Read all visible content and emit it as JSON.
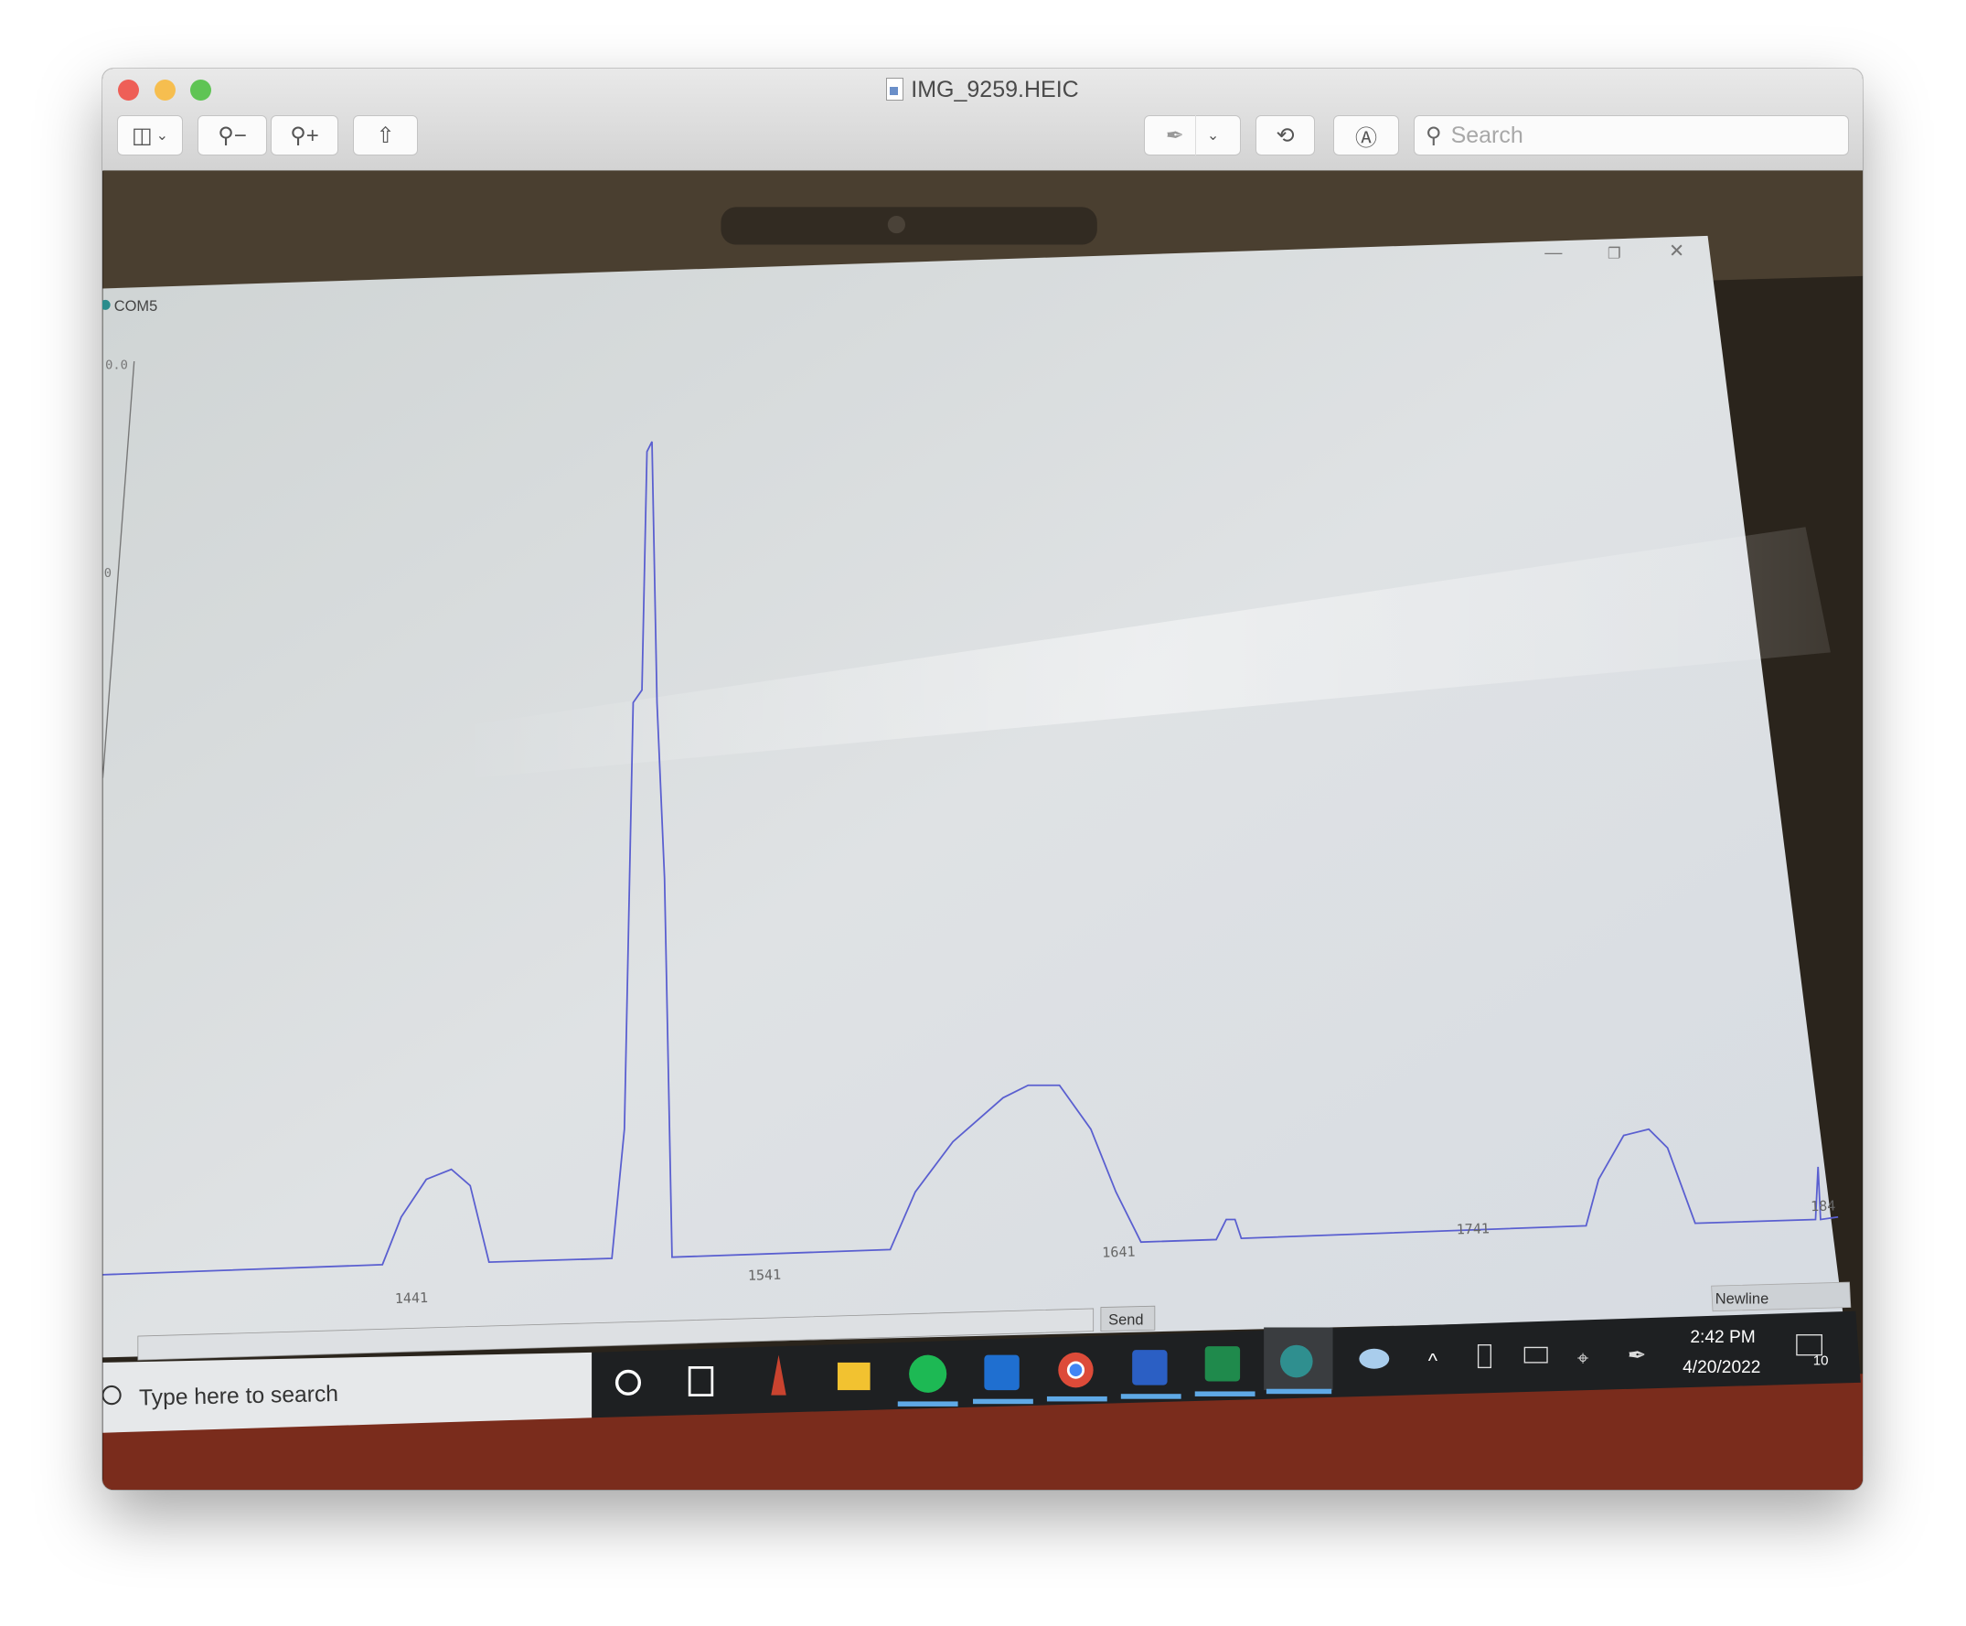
{
  "window": {
    "title": "IMG_9259.HEIC",
    "traffic_lights": {
      "close": "#ee5f57",
      "minimize": "#f6be4f",
      "zoom": "#5fc454"
    }
  },
  "toolbar": {
    "sidebar_icon": "sidebar-icon",
    "zoom_out_icon": "zoom-out-icon",
    "zoom_in_icon": "zoom-in-icon",
    "share_icon": "share-icon",
    "markup_icon": "highlighter-icon",
    "rotate_icon": "rotate-left-icon",
    "annotate_icon": "markup-pen-icon",
    "search_placeholder": "Search"
  },
  "photo": {
    "serial_plotter": {
      "port": "COM5",
      "y_labels": [
        "0.0",
        "0"
      ],
      "x_labels": [
        "1441",
        "1541",
        "1641",
        "1741",
        "184"
      ],
      "line_color": "#5a5fd0",
      "send_label": "Send",
      "line_ending": "Newline"
    },
    "taskbar": {
      "search_placeholder": "Type here to search",
      "time": "2:42 PM",
      "date": "4/20/2022",
      "notification_count": "10",
      "apps": [
        "cortana",
        "task-view",
        "pencil",
        "file-explorer",
        "spotify",
        "outlook",
        "chrome",
        "word",
        "excel",
        "arduino"
      ]
    }
  }
}
